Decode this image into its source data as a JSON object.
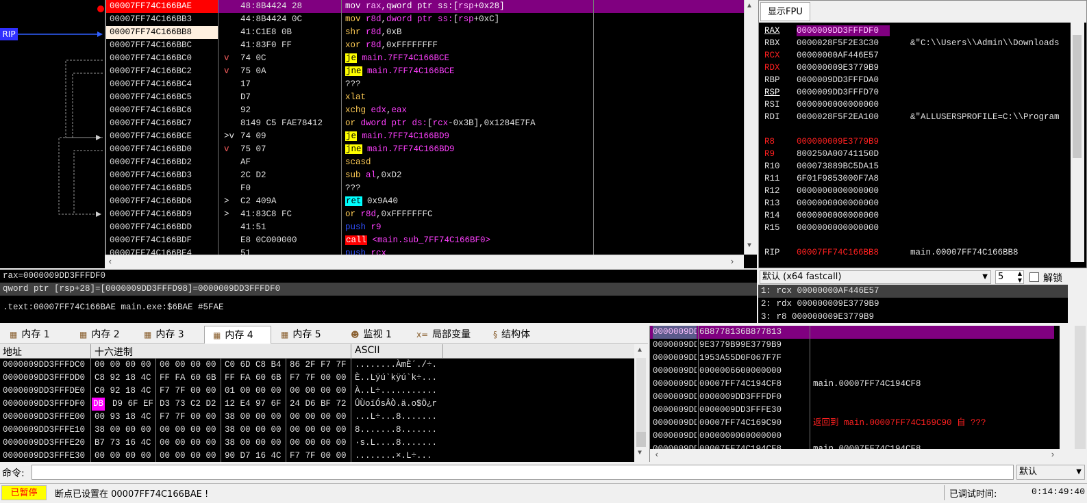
{
  "rip_label": "RIP",
  "disasm": {
    "rows": [
      {
        "addr": "00007FF74C166BAE",
        "bytes": "48:8B4424 28",
        "mark": "",
        "parts": [
          [
            "mov ",
            "kw-purple"
          ],
          [
            "rax",
            "reg"
          ],
          [
            ",",
            "w"
          ],
          [
            "qword ptr ss:",
            "kw-purple"
          ],
          [
            "[",
            "w"
          ],
          [
            "rsp",
            "reg"
          ],
          [
            "+0x28]",
            "w"
          ]
        ]
      },
      {
        "addr": "00007FF74C166BB3",
        "bytes": "44:8B4424 0C",
        "mark": "",
        "parts": [
          [
            "mov ",
            "yw"
          ],
          [
            "r8d",
            "reg"
          ],
          [
            ",",
            "w"
          ],
          [
            "dword ptr ss:",
            "purple"
          ],
          [
            "[",
            "w"
          ],
          [
            "rsp",
            "reg"
          ],
          [
            "+0xC]",
            "w"
          ]
        ]
      },
      {
        "addr": "00007FF74C166BB8",
        "bytes": "41:C1E8 0B",
        "mark": "",
        "parts": [
          [
            "shr ",
            "yw"
          ],
          [
            "r8d",
            "reg"
          ],
          [
            ",0xB",
            "w"
          ]
        ]
      },
      {
        "addr": "00007FF74C166BBC",
        "bytes": "41:83F0 FF",
        "mark": "",
        "parts": [
          [
            "xor ",
            "yw"
          ],
          [
            "r8d",
            "reg"
          ],
          [
            ",0xFFFFFFFF",
            "w"
          ]
        ]
      },
      {
        "addr": "00007FF74C166BC0",
        "bytes": "74 0C",
        "mark": "v",
        "parts": [
          [
            "je",
            "jcc"
          ],
          [
            " main.7FF74C166BCE",
            "mag"
          ]
        ]
      },
      {
        "addr": "00007FF74C166BC2",
        "bytes": "75 0A",
        "mark": "v",
        "parts": [
          [
            "jne",
            "jcc"
          ],
          [
            " main.7FF74C166BCE",
            "mag"
          ]
        ]
      },
      {
        "addr": "00007FF74C166BC4",
        "bytes": "17",
        "mark": "",
        "parts": [
          [
            "???",
            "w"
          ]
        ]
      },
      {
        "addr": "00007FF74C166BC5",
        "bytes": "D7",
        "mark": "",
        "parts": [
          [
            "xlat",
            "yw"
          ]
        ]
      },
      {
        "addr": "00007FF74C166BC6",
        "bytes": "92",
        "mark": "",
        "parts": [
          [
            "xchg ",
            "yw"
          ],
          [
            "edx",
            "reg"
          ],
          [
            ",",
            "w"
          ],
          [
            "eax",
            "reg"
          ]
        ]
      },
      {
        "addr": "00007FF74C166BC7",
        "bytes": "8149 C5 FAE78412",
        "mark": "",
        "parts": [
          [
            "or ",
            "yw"
          ],
          [
            "dword ptr ds:",
            "purple"
          ],
          [
            "[",
            "w"
          ],
          [
            "rcx",
            "reg"
          ],
          [
            "-0x3B],0x1284E7FA",
            "w"
          ]
        ]
      },
      {
        "addr": "00007FF74C166BCE",
        "bytes": "74 09",
        "mark": ">v",
        "parts": [
          [
            "je",
            "jcc"
          ],
          [
            " main.7FF74C166BD9",
            "mag"
          ]
        ]
      },
      {
        "addr": "00007FF74C166BD0",
        "bytes": "75 07",
        "mark": "v",
        "parts": [
          [
            "jne",
            "jcc"
          ],
          [
            " main.7FF74C166BD9",
            "mag"
          ]
        ]
      },
      {
        "addr": "00007FF74C166BD2",
        "bytes": "AF",
        "mark": "",
        "parts": [
          [
            "scasd",
            "yw"
          ]
        ]
      },
      {
        "addr": "00007FF74C166BD3",
        "bytes": "2C D2",
        "mark": "",
        "parts": [
          [
            "sub ",
            "yw"
          ],
          [
            "al",
            "reg"
          ],
          [
            ",0xD2",
            "w"
          ]
        ]
      },
      {
        "addr": "00007FF74C166BD5",
        "bytes": "F0",
        "mark": "",
        "parts": [
          [
            "???",
            "w"
          ]
        ]
      },
      {
        "addr": "00007FF74C166BD6",
        "bytes": "C2 409A",
        "mark": ">",
        "parts": [
          [
            "ret",
            "ret"
          ],
          [
            " 0x9A40",
            "w"
          ]
        ]
      },
      {
        "addr": "00007FF74C166BD9",
        "bytes": "41:83C8 FC",
        "mark": ">",
        "parts": [
          [
            "or ",
            "yw"
          ],
          [
            "r8d",
            "reg"
          ],
          [
            ",0xFFFFFFFC",
            "w"
          ]
        ]
      },
      {
        "addr": "00007FF74C166BDD",
        "bytes": "41:51",
        "mark": "",
        "parts": [
          [
            "push ",
            "blue"
          ],
          [
            "r9",
            "reg"
          ]
        ]
      },
      {
        "addr": "00007FF74C166BDF",
        "bytes": "E8 0C000000",
        "mark": "",
        "parts": [
          [
            "call",
            "call"
          ],
          [
            " <main.sub_7FF74C166BF0>",
            "mag"
          ]
        ]
      },
      {
        "addr": "00007FF74C166BE4",
        "bytes": "51",
        "mark": "",
        "parts": [
          [
            "push ",
            "blue"
          ],
          [
            "rcx",
            "reg"
          ]
        ]
      }
    ]
  },
  "registers": {
    "tab_label": "显示FPU",
    "rows": [
      {
        "name": "RAX",
        "value": "0000009DD3FFFDF0",
        "comment": "",
        "name_color": "#ffffff",
        "val_color": "#ff40ff",
        "underline": true
      },
      {
        "name": "RBX",
        "value": "0000028F5F2E3C30",
        "comment": "&\"C:\\\\Users\\\\Admin\\\\Downloads",
        "name_color": "#e0e0e0",
        "val_color": "#e0e0e0",
        "underline": false
      },
      {
        "name": "RCX",
        "value": "00000000AF446E57",
        "comment": "",
        "name_color": "#ff2020",
        "val_color": "#e0e0e0",
        "underline": false
      },
      {
        "name": "RDX",
        "value": "000000009E3779B9",
        "comment": "",
        "name_color": "#ff2020",
        "val_color": "#e0e0e0",
        "underline": false
      },
      {
        "name": "RBP",
        "value": "0000009DD3FFFDA0",
        "comment": "",
        "name_color": "#e0e0e0",
        "val_color": "#e0e0e0",
        "underline": false
      },
      {
        "name": "RSP",
        "value": "0000009DD3FFFD70",
        "comment": "",
        "name_color": "#ffffff",
        "val_color": "#e0e0e0",
        "underline": true
      },
      {
        "name": "RSI",
        "value": "0000000000000000",
        "comment": "",
        "name_color": "#e0e0e0",
        "val_color": "#e0e0e0",
        "underline": false
      },
      {
        "name": "RDI",
        "value": "0000028F5F2EA100",
        "comment": "&\"ALLUSERSPROFILE=C:\\\\Program",
        "name_color": "#e0e0e0",
        "val_color": "#e0e0e0",
        "underline": false
      },
      {
        "name": "",
        "value": "",
        "comment": "",
        "name_color": "#e0e0e0",
        "val_color": "#e0e0e0",
        "underline": false
      },
      {
        "name": "R8",
        "value": "000000009E3779B9",
        "comment": "",
        "name_color": "#ff2020",
        "val_color": "#ff2020",
        "underline": false
      },
      {
        "name": "R9",
        "value": "800250A00741150D",
        "comment": "",
        "name_color": "#ff2020",
        "val_color": "#e0e0e0",
        "underline": false
      },
      {
        "name": "R10",
        "value": "000073889BC5DA15",
        "comment": "",
        "name_color": "#e0e0e0",
        "val_color": "#e0e0e0",
        "underline": false
      },
      {
        "name": "R11",
        "value": "6F01F9853000F7A8",
        "comment": "",
        "name_color": "#e0e0e0",
        "val_color": "#e0e0e0",
        "underline": false
      },
      {
        "name": "R12",
        "value": "0000000000000000",
        "comment": "",
        "name_color": "#e0e0e0",
        "val_color": "#e0e0e0",
        "underline": false
      },
      {
        "name": "R13",
        "value": "0000000000000000",
        "comment": "",
        "name_color": "#e0e0e0",
        "val_color": "#e0e0e0",
        "underline": false
      },
      {
        "name": "R14",
        "value": "0000000000000000",
        "comment": "",
        "name_color": "#e0e0e0",
        "val_color": "#e0e0e0",
        "underline": false
      },
      {
        "name": "R15",
        "value": "0000000000000000",
        "comment": "",
        "name_color": "#e0e0e0",
        "val_color": "#e0e0e0",
        "underline": false
      },
      {
        "name": "",
        "value": "",
        "comment": "",
        "name_color": "#e0e0e0",
        "val_color": "#e0e0e0",
        "underline": false
      },
      {
        "name": "RIP",
        "value": "00007FF74C166BB8",
        "comment": "main.00007FF74C166BB8",
        "name_color": "#e0e0e0",
        "val_color": "#ff2020",
        "underline": false
      }
    ]
  },
  "callconv": {
    "selected": "默认 (x64 fastcall)",
    "spin_value": "5",
    "lock_label": "解锁"
  },
  "args": [
    "1: rcx 00000000AF446E57",
    "2: rdx 000000009E3779B9",
    "3: r8 000000009E3779B9"
  ],
  "info": {
    "line1": "rax=0000009DD3FFFDF0",
    "line2": "qword ptr [rsp+28]=[0000009DD3FFFD98]=0000009DD3FFFDF0",
    "line3": ".text:00007FF74C166BAE main.exe:$6BAE #5FAE"
  },
  "tabs": [
    {
      "label": "内存 1",
      "icon": "memory-icon"
    },
    {
      "label": "内存 2",
      "icon": "memory-icon"
    },
    {
      "label": "内存 3",
      "icon": "memory-icon"
    },
    {
      "label": "内存 4",
      "icon": "memory-icon"
    },
    {
      "label": "内存 5",
      "icon": "memory-icon"
    },
    {
      "label": "监视 1",
      "icon": "watch-icon"
    },
    {
      "label": "局部变量",
      "icon": "locals-icon"
    },
    {
      "label": "结构体",
      "icon": "struct-icon"
    }
  ],
  "dump": {
    "headers": {
      "addr": "地址",
      "hex": "十六进制",
      "ascii": "ASCII"
    },
    "rows": [
      {
        "addr": "0000009DD3FFFDC0",
        "hex": [
          "00 00 00 00",
          "00 00 00 00",
          "C0 6D C8 B4",
          "86 2F F7 7F"
        ],
        "ascii": "........ÀmÈ´./÷."
      },
      {
        "addr": "0000009DD3FFFDD0",
        "hex": [
          "C8 92 18 4C",
          "FF FA 60 6B",
          "FF FA 60 6B",
          "F7 7F 00 00"
        ],
        "ascii": "È..Lÿú`kÿú`k÷..."
      },
      {
        "addr": "0000009DD3FFFDE0",
        "hex": [
          "C0 92 18 4C",
          "F7 7F 00 00",
          "01 00 00 00",
          "00 00 00 00"
        ],
        "ascii": "À..L÷..........."
      },
      {
        "addr": "0000009DD3FFFDF0",
        "hex": [
          "DB D9 6F EF",
          "D3 73 C2 D2",
          "12 E4 97 6F",
          "24 D6 BF 72"
        ],
        "ascii": "ÛÙoïÓsÂÒ.ä.o$Ö¿r"
      },
      {
        "addr": "0000009DD3FFFE00",
        "hex": [
          "00 93 18 4C",
          "F7 7F 00 00",
          "38 00 00 00",
          "00 00 00 00"
        ],
        "ascii": "...L÷...8......."
      },
      {
        "addr": "0000009DD3FFFE10",
        "hex": [
          "38 00 00 00",
          "00 00 00 00",
          "38 00 00 00",
          "00 00 00 00"
        ],
        "ascii": "8.......8......."
      },
      {
        "addr": "0000009DD3FFFE20",
        "hex": [
          "B7 73 16 4C",
          "00 00 00 00",
          "38 00 00 00",
          "00 00 00 00"
        ],
        "ascii": "·s.L....8......."
      },
      {
        "addr": "0000009DD3FFFE30",
        "hex": [
          "00 00 00 00",
          "00 00 00 00",
          "90 D7 16 4C",
          "F7 7F 00 00"
        ],
        "ascii": "........×.L÷..."
      }
    ]
  },
  "stack": {
    "rows": [
      {
        "addr": "0000009DD3FFFD70",
        "value": "6B8778136B877813",
        "comment": ""
      },
      {
        "addr": "0000009DD3FFFD78",
        "value": "9E3779B99E3779B9",
        "comment": ""
      },
      {
        "addr": "0000009DD3FFFD80",
        "value": "1953A55D0F067F7F",
        "comment": ""
      },
      {
        "addr": "0000009DD3FFFD88",
        "value": "0000006600000000",
        "comment": ""
      },
      {
        "addr": "0000009DD3FFFD90",
        "value": "00007FF74C194CF8",
        "comment": "main.00007FF74C194CF8"
      },
      {
        "addr": "0000009DD3FFFD98",
        "value": "0000009DD3FFFDF0",
        "comment": ""
      },
      {
        "addr": "0000009DD3FFFDA0",
        "value": "0000009DD3FFFE30",
        "comment": ""
      },
      {
        "addr": "0000009DD3FFFDA8",
        "value": "00007FF74C169C90",
        "comment": "返回到 main.00007FF74C169C90 自 ???"
      },
      {
        "addr": "0000009DD3FFFDB0",
        "value": "0000000000000000",
        "comment": ""
      },
      {
        "addr": "0000009DD3FFFDB8",
        "value": "00007FF74C194CF8",
        "comment": "main.00007FF74C194CF8"
      }
    ]
  },
  "command": {
    "label": "命令:",
    "value": "",
    "mode": "默认"
  },
  "status": {
    "state": "已暂停",
    "message": "断点已设置在 00007FF74C166BAE !",
    "time_label": "已调试时间:",
    "time": "0:14:49:40"
  },
  "colors": {
    "purple_sel": "#800080",
    "bp_red": "#ff0000",
    "rip_blue": "#3030ff"
  }
}
